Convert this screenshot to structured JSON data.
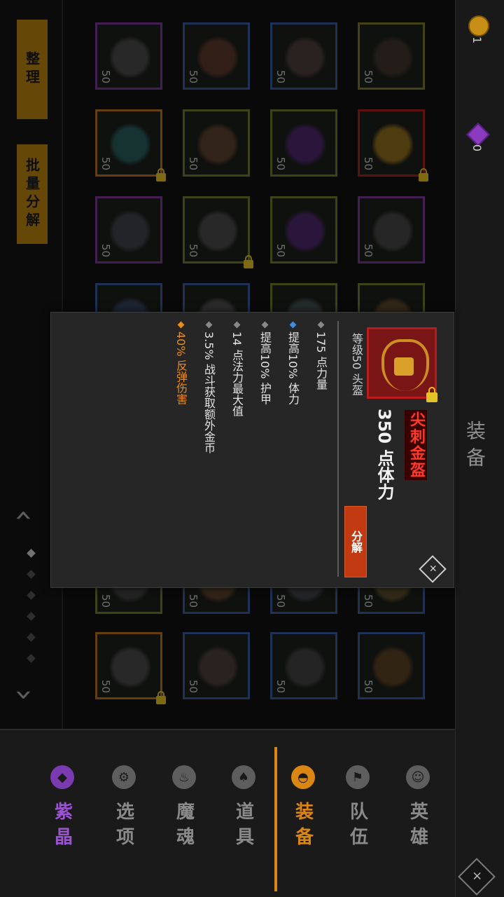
{
  "actions": {
    "sort_label": "整理",
    "batch_decompose_label": "批量分解"
  },
  "currency": {
    "gold": "1",
    "gems": "0"
  },
  "section_title": "装备",
  "grid": {
    "slots": [
      {
        "level": "50",
        "color": "#7a3a9a",
        "item_color": "#555555",
        "locked": false
      },
      {
        "level": "50",
        "color": "#3a5a9a",
        "item_color": "#6a4030",
        "locked": false
      },
      {
        "level": "50",
        "color": "#3a5a9a",
        "item_color": "#5a4545",
        "locked": false
      },
      {
        "level": "50",
        "color": "#7c7a2a",
        "item_color": "#4a3a30",
        "locked": false
      },
      {
        "level": "50",
        "color": "#b8721c",
        "item_color": "#2a6a6a",
        "locked": true
      },
      {
        "level": "50",
        "color": "#6c7a2a",
        "item_color": "#6a4a30",
        "locked": false
      },
      {
        "level": "50",
        "color": "#6c7a2a",
        "item_color": "#5a2a80",
        "locked": false
      },
      {
        "level": "50",
        "color": "#a8241a",
        "item_color": "#a8801c",
        "locked": true
      },
      {
        "level": "50",
        "color": "#7a3a9a",
        "item_color": "#4a4a55",
        "locked": false
      },
      {
        "level": "50",
        "color": "#6c7a2a",
        "item_color": "#555555",
        "locked": true
      },
      {
        "level": "50",
        "color": "#6c7a2a",
        "item_color": "#5a2a80",
        "locked": false
      },
      {
        "level": "50",
        "color": "#7a3a9a",
        "item_color": "#505050",
        "locked": false
      },
      {
        "level": "50",
        "color": "#3a5a9a",
        "item_color": "#3a4a6a",
        "locked": false
      },
      {
        "level": "50",
        "color": "#3a5a9a",
        "item_color": "#5a5a5a",
        "locked": false
      },
      {
        "level": "50",
        "color": "#6c7a2a",
        "item_color": "#4a5a5a",
        "locked": false
      },
      {
        "level": "50",
        "color": "#6c7a2a",
        "item_color": "#6a5030",
        "locked": false
      },
      {
        "level": "50",
        "color": "#6c7a2a",
        "item_color": "#4a4a4a",
        "locked": false
      },
      {
        "level": "50",
        "color": "#3a5a9a",
        "item_color": "#6a4a30",
        "locked": false
      },
      {
        "level": "50",
        "color": "#3a5a9a",
        "item_color": "#4a4a55",
        "locked": false
      },
      {
        "level": "50",
        "color": "#3a5a9a",
        "item_color": "#6a5a30",
        "locked": false
      },
      {
        "level": "50",
        "color": "#b8721c",
        "item_color": "#555555",
        "locked": true
      },
      {
        "level": "50",
        "color": "#3a5a9a",
        "item_color": "#5a4545",
        "locked": false
      },
      {
        "level": "50",
        "color": "#3a5a9a",
        "item_color": "#4a4a4a",
        "locked": false
      },
      {
        "level": "50",
        "color": "#3a5a9a",
        "item_color": "#6a4a25",
        "locked": false
      }
    ]
  },
  "pager": {
    "prev": "‹",
    "next": "›",
    "pages": 6,
    "active_index": 0
  },
  "nav": [
    {
      "label": "英雄",
      "icon": "hero-icon",
      "state": "normal"
    },
    {
      "label": "队伍",
      "icon": "team-icon",
      "state": "normal"
    },
    {
      "label": "装备",
      "icon": "helmet-icon",
      "state": "active"
    },
    {
      "label": "道具",
      "icon": "item-bag-icon",
      "state": "normal"
    },
    {
      "label": "魔魂",
      "icon": "soul-flame-icon",
      "state": "normal"
    },
    {
      "label": "选项",
      "icon": "gear-icon",
      "state": "normal"
    },
    {
      "label": "紫晶",
      "icon": "purple-crystal-icon",
      "state": "purple"
    }
  ],
  "detail": {
    "name": "尖刺金盔",
    "main_stat": "350 点体力",
    "subtitle": "等级50 头盔",
    "decompose_label": "分解",
    "close_symbol": "×",
    "stats": [
      {
        "text": "175 点力量",
        "style": "normal"
      },
      {
        "text": "提高10% 体力",
        "style": "blue"
      },
      {
        "text": "提高10% 护甲",
        "style": "normal"
      },
      {
        "text": "14 点法力最大值",
        "style": "normal"
      },
      {
        "text": "3.5% 战斗获取额外金币",
        "style": "normal"
      },
      {
        "text": "40% 反弹伤害",
        "style": "orange"
      }
    ],
    "colors": {
      "name": "#ff3a2a",
      "special": "#ee8a18",
      "accent": "#d98612"
    }
  },
  "bottom_close_symbol": "×"
}
